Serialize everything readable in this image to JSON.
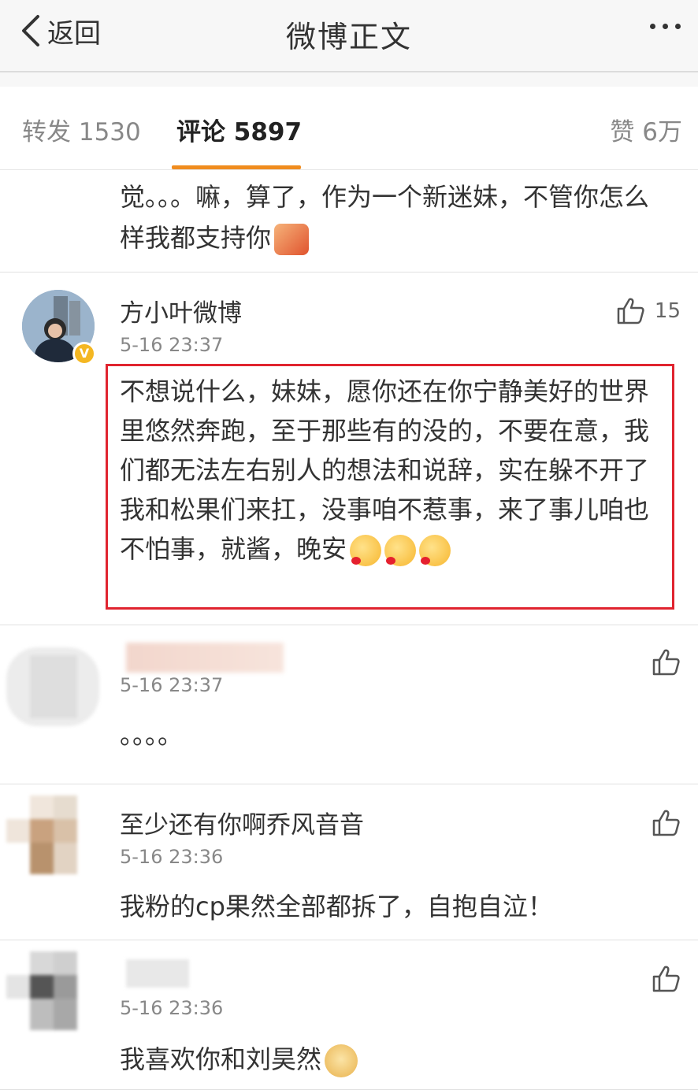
{
  "nav": {
    "back_label": "返回",
    "title": "微博正文"
  },
  "tabs": {
    "repost": "转发 1530",
    "comment": "评论 5897",
    "like": "赞 6万"
  },
  "comments": [
    {
      "text": "觉。。。嘛，算了，作为一个新迷妹，不管你怎么样我都支持你"
    },
    {
      "name": "方小叶微博",
      "time": "5-16 23:37",
      "likes": "15",
      "text": "不想说什么，妹妹，愿你还在你宁静美好的世界里悠然奔跑，至于那些有的没的，不要在意，我们都无法左右别人的想法和说辞，实在躲不开了我和松果们来扛，没事咱不惹事，来了事儿咱也不怕事，就酱，晚安"
    },
    {
      "name": "",
      "time": "5-16 23:37",
      "text": "。。。。"
    },
    {
      "name": "至少还有你啊乔风音音",
      "time": "5-16 23:36",
      "text": "我粉的cp果然全部都拆了，自抱自泣！"
    },
    {
      "name": "",
      "time": "5-16 23:36",
      "text": "我喜欢你和刘昊然"
    }
  ],
  "colors": {
    "accent": "#f08c1e",
    "highlight_border": "#e0242f",
    "verified_badge": "#f4b722"
  },
  "icons": [
    "back-chevron-icon",
    "more-icon",
    "thumbs-up-icon",
    "verified-badge-icon"
  ]
}
